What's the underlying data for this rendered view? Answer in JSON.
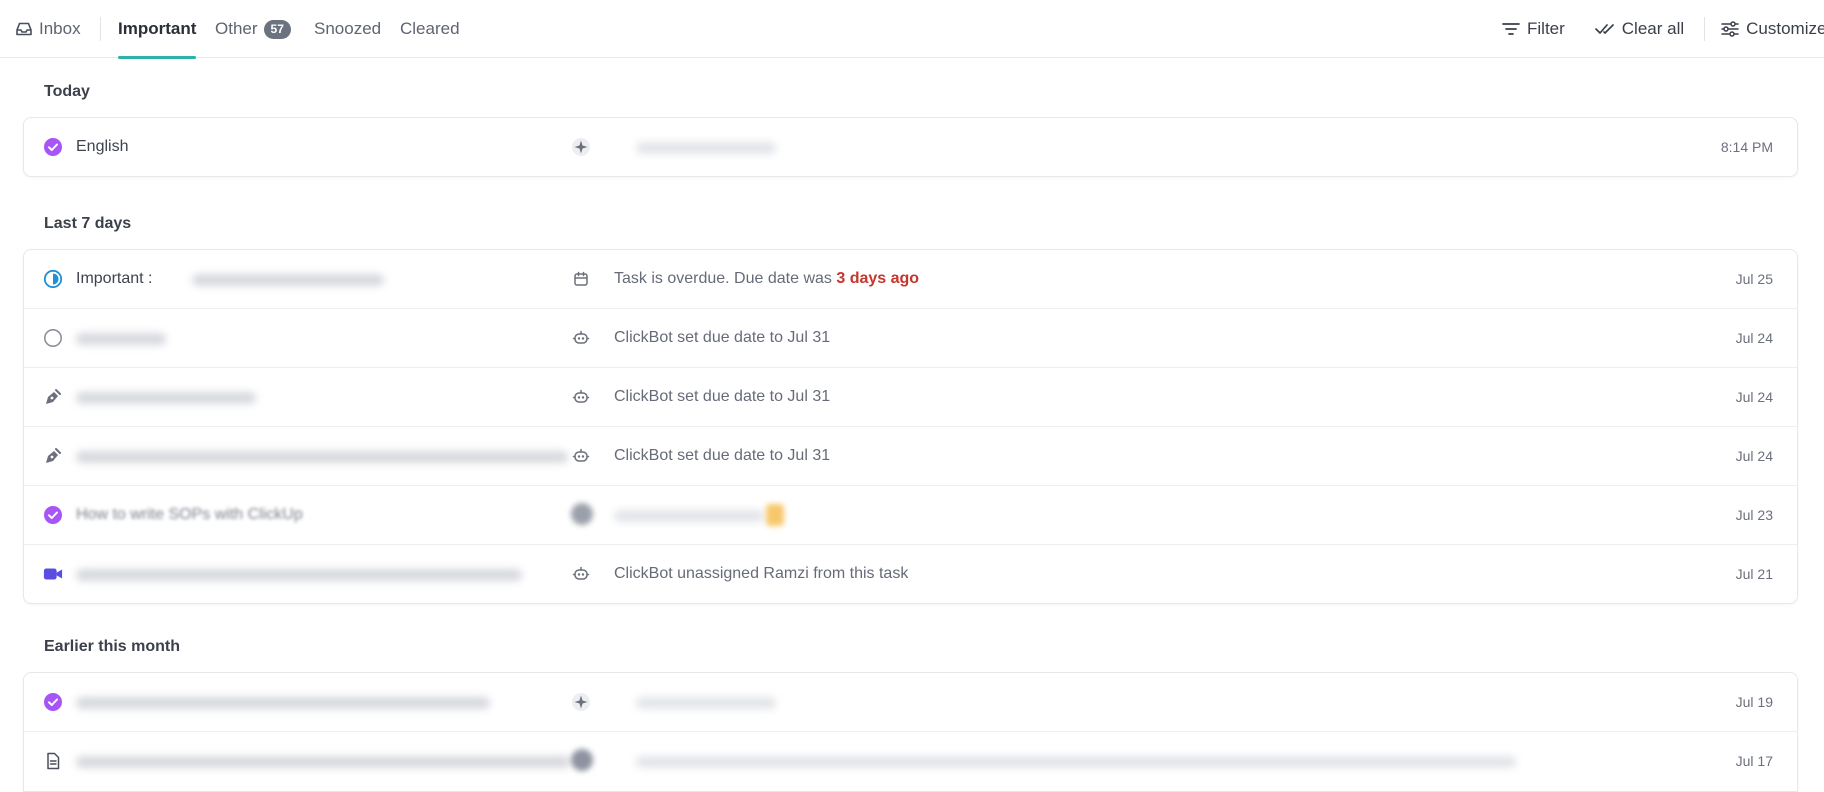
{
  "tabs": {
    "inbox": "Inbox",
    "important": "Important",
    "other": "Other",
    "other_count": "57",
    "snoozed": "Snoozed",
    "cleared": "Cleared"
  },
  "actions": {
    "filter": "Filter",
    "clear_all": "Clear all",
    "customize": "Customize"
  },
  "colors": {
    "accent": "#2ab3a6",
    "complete": "#a855f7",
    "overdue": "#c4362e",
    "video": "#5b4de0"
  },
  "sections": {
    "today": {
      "title": "Today",
      "rows": [
        {
          "status_icon": "check-circle-icon",
          "title": "English",
          "activity_icon": "sparkle-icon",
          "activity": "",
          "date": "8:14 PM"
        }
      ]
    },
    "last7": {
      "title": "Last 7 days",
      "rows": [
        {
          "status_icon": "half-circle-icon",
          "title": "Important : ",
          "activity_icon": "calendar-icon",
          "activity": "Task is overdue. Due date was ",
          "activity_highlight": "3 days ago",
          "date": "Jul 25"
        },
        {
          "status_icon": "empty-circle-icon",
          "title": "",
          "activity_icon": "robot-icon",
          "activity": "ClickBot set due date to Jul 31",
          "date": "Jul 24"
        },
        {
          "status_icon": "pen-icon",
          "title": "",
          "activity_icon": "robot-icon",
          "activity": "ClickBot set due date to Jul 31",
          "date": "Jul 24"
        },
        {
          "status_icon": "pen-icon",
          "title": "",
          "activity_icon": "robot-icon",
          "activity": "ClickBot set due date to Jul 31",
          "date": "Jul 24"
        },
        {
          "status_icon": "check-circle-icon",
          "title": "How to write SOPs with ClickUp",
          "activity_icon": "avatar",
          "activity": "",
          "date": "Jul 23"
        },
        {
          "status_icon": "video-icon",
          "title": "",
          "activity_icon": "robot-icon",
          "activity": "ClickBot unassigned Ramzi from this task",
          "date": "Jul 21"
        }
      ]
    },
    "earlier": {
      "title": "Earlier this month",
      "rows": [
        {
          "status_icon": "check-circle-icon",
          "title": "",
          "activity_icon": "sparkle-icon",
          "activity": "",
          "date": "Jul 19"
        },
        {
          "status_icon": "document-icon",
          "title": "",
          "activity_icon": "avatar",
          "activity": "",
          "date": "Jul 17"
        }
      ]
    }
  }
}
